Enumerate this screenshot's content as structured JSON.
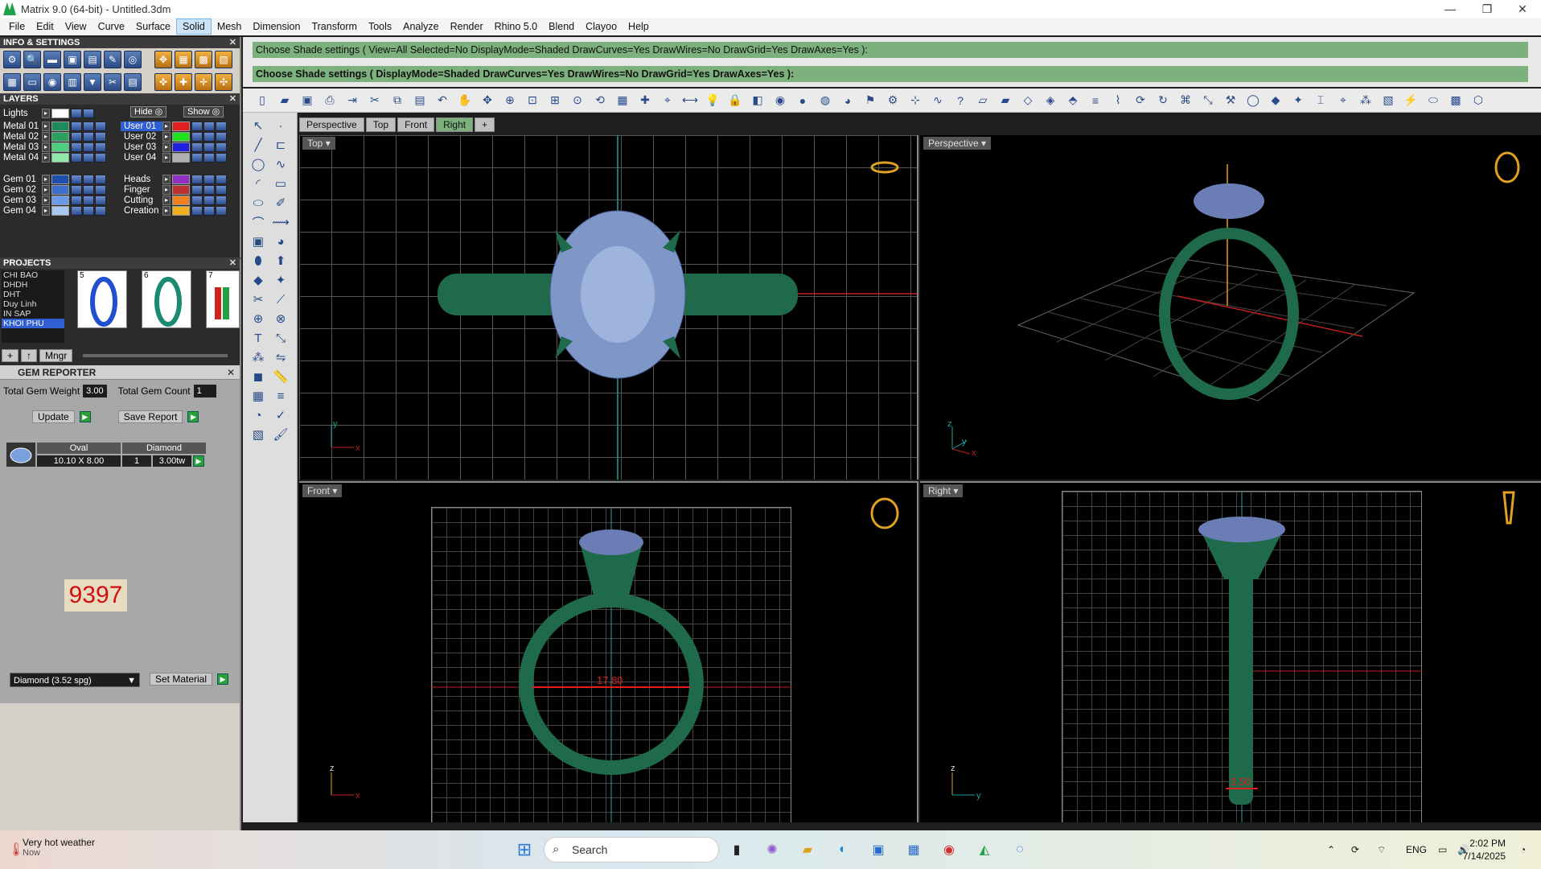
{
  "window": {
    "title": "Matrix 9.0 (64-bit) - Untitled.3dm",
    "minimize": "—",
    "maximize": "❐",
    "close": "✕"
  },
  "menu": [
    "File",
    "Edit",
    "View",
    "Curve",
    "Surface",
    "Solid",
    "Mesh",
    "Dimension",
    "Transform",
    "Tools",
    "Analyze",
    "Render",
    "Rhino 5.0",
    "Blend",
    "Clayoo",
    "Help"
  ],
  "menu_active": "Solid",
  "panels": {
    "info_title": "INFO & SETTINGS",
    "layers_title": "LAYERS",
    "projects_title": "PROJECTS",
    "gem_title": "GEM REPORTER"
  },
  "layers": {
    "lights": "Lights",
    "hide": "Hide",
    "show": "Show",
    "left": [
      {
        "name": "Metal 01",
        "color": "#1e8c5a"
      },
      {
        "name": "Metal 02",
        "color": "#28a060"
      },
      {
        "name": "Metal 03",
        "color": "#4cd080"
      },
      {
        "name": "Metal 04",
        "color": "#90e8a8"
      },
      {
        "name": "Gem 01",
        "color": "#1f4fb0"
      },
      {
        "name": "Gem 02",
        "color": "#3a6fd0"
      },
      {
        "name": "Gem 03",
        "color": "#6a9ae8"
      },
      {
        "name": "Gem 04",
        "color": "#a8c8f0"
      }
    ],
    "right": [
      {
        "name": "User 01",
        "color": "#e02020"
      },
      {
        "name": "User 02",
        "color": "#20e020"
      },
      {
        "name": "User 03",
        "color": "#2020e0"
      },
      {
        "name": "User 04",
        "color": "#b0b0b0"
      },
      {
        "name": "Heads",
        "color": "#9030c0"
      },
      {
        "name": "Finger",
        "color": "#c03030"
      },
      {
        "name": "Cutting",
        "color": "#f08020"
      },
      {
        "name": "Creation",
        "color": "#f0b020"
      }
    ]
  },
  "projects": {
    "list": [
      "CHI BAO",
      "DHDH",
      "DHT",
      "Duy Linh",
      "IN SAP",
      "KHOI PHU"
    ],
    "selected": "KHOI PHU",
    "thumbs": [
      "5",
      "6",
      "7"
    ],
    "mngr": "Mngr"
  },
  "gem": {
    "weight_label": "Total Gem Weight",
    "weight": "3.00",
    "count_label": "Total Gem Count",
    "count": "1",
    "update": "Update",
    "save": "Save Report",
    "col_shape": "Oval",
    "col_material": "Diamond",
    "size": "10.10 X 8.00",
    "qty": "1",
    "ctw": "3.00tw",
    "counter": "9397",
    "material_select": "Diamond   (3.52 spg)",
    "set_material": "Set Material"
  },
  "command": {
    "line1": "Choose Shade settings ( View=All  Selected=No  DisplayMode=Shaded  DrawCurves=Yes  DrawWires=No  DrawGrid=Yes  DrawAxes=Yes ):",
    "line2": "Choose Shade settings ( DisplayMode=Shaded  DrawCurves=Yes  DrawWires=No  DrawGrid=Yes  DrawAxes=Yes ):"
  },
  "viewport_tabs": [
    "Perspective",
    "Top",
    "Front",
    "Right",
    "+"
  ],
  "viewport_tab_selected": "Right",
  "viewports": {
    "top": "Top",
    "perspective": "Perspective",
    "front": "Front",
    "right": "Right",
    "front_dim": "17.80",
    "right_dim": "2.50"
  },
  "taskbar": {
    "weather": "Very hot weather",
    "weather_sub": "Now",
    "search": "Search",
    "lang": "ENG",
    "time": "2:02 PM",
    "date": "7/14/2025"
  }
}
